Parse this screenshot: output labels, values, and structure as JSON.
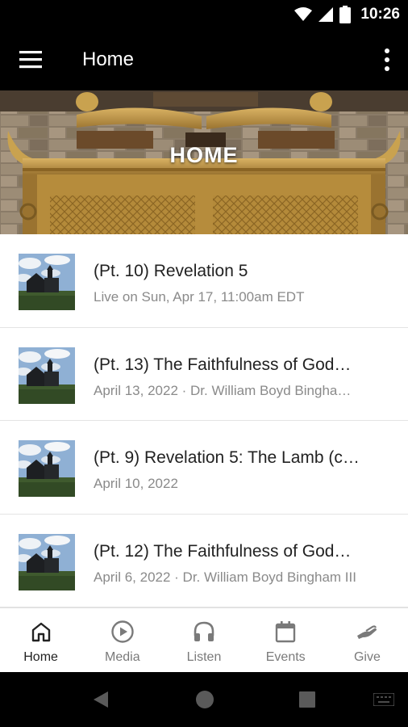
{
  "status_bar": {
    "time": "10:26"
  },
  "app_bar": {
    "title": "Home"
  },
  "hero": {
    "title": "HOME"
  },
  "items": [
    {
      "title": "(Pt. 10) Revelation 5",
      "subtitle": "Live on Sun, Apr 17, 11:00am EDT"
    },
    {
      "title": "(Pt. 13) The Faithfulness of God…",
      "subtitle": "April 13, 2022 · Dr. William Boyd Bingha…"
    },
    {
      "title": "(Pt. 9) Revelation 5: The Lamb (c…",
      "subtitle": "April 10, 2022"
    },
    {
      "title": "(Pt. 12) The Faithfulness of God…",
      "subtitle": "April 6, 2022 · Dr. William Boyd Bingham III"
    }
  ],
  "bottom_nav": [
    {
      "label": "Home",
      "icon": "home-icon",
      "active": true
    },
    {
      "label": "Media",
      "icon": "play-circle-icon",
      "active": false
    },
    {
      "label": "Listen",
      "icon": "headphones-icon",
      "active": false
    },
    {
      "label": "Events",
      "icon": "calendar-icon",
      "active": false
    },
    {
      "label": "Give",
      "icon": "give-hand-icon",
      "active": false
    }
  ],
  "colors": {
    "app_bar": "#000000",
    "active_tab": "#222222",
    "inactive_tab": "#7a7a7a",
    "subtitle": "#8a8a8a"
  }
}
